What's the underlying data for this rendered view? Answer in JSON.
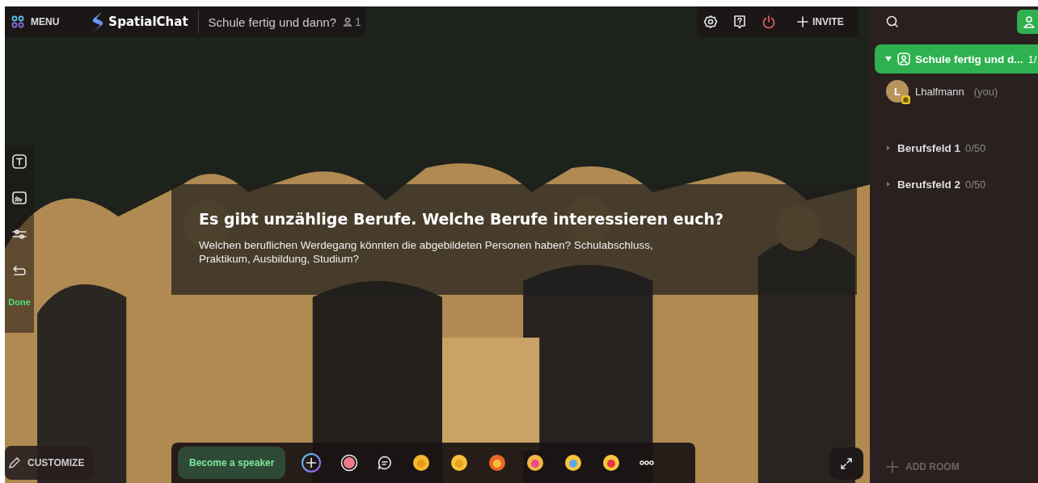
{
  "top_bar": {
    "menu_label": "MENU",
    "logo": "SpatialChat",
    "space_title": "Schule fertig und dann?",
    "participant_count": "1",
    "invite_label": "INVITE"
  },
  "tools": {
    "done_label": "Done"
  },
  "announcement": {
    "title": "Es gibt unzählige Berufe. Welche Berufe interessieren euch?",
    "body": "Welchen beruflichen Werdegang könnten die abgebildeten Personen haben? Schulabschluss, Praktikum, Ausbildung, Studium?"
  },
  "bottom_bar": {
    "customize_label": "CUSTOMIZE",
    "speaker_label": "Become a speaker"
  },
  "sidebar": {
    "rooms": [
      {
        "name": "Schule fertig und d...",
        "count": "1/",
        "selected": true,
        "expanded": true,
        "participants": [
          {
            "initial": "L",
            "name": "Lhalfmann",
            "note": "(you)"
          }
        ]
      },
      {
        "name": "Berufsfeld 1",
        "count": "0/50",
        "selected": false,
        "expanded": false
      },
      {
        "name": "Berufsfeld 2",
        "count": "0/50",
        "selected": false,
        "expanded": false
      }
    ],
    "add_room_label": "ADD ROOM"
  }
}
